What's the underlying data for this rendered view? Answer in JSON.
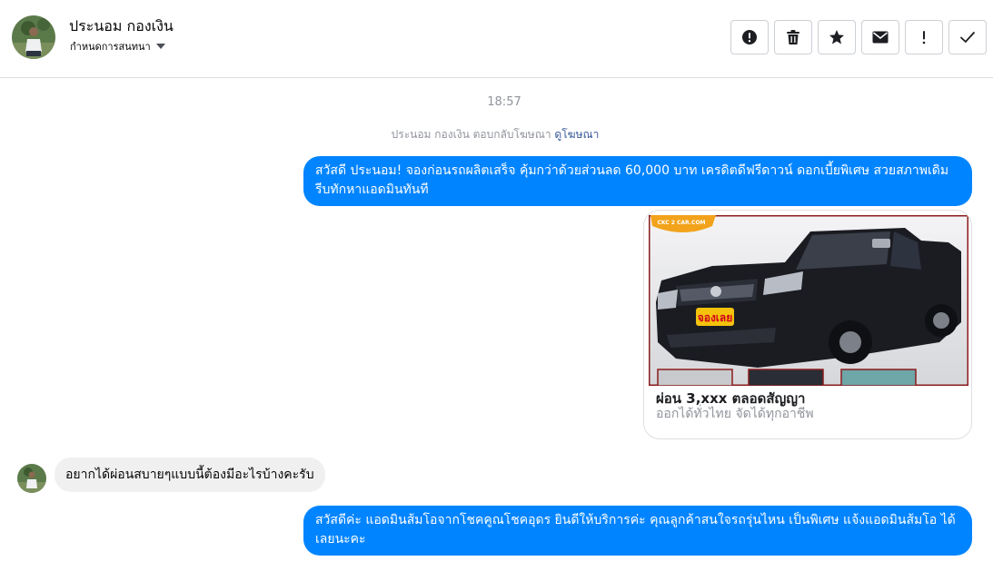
{
  "header": {
    "contact_name": "ประนอม กองเงิน",
    "conversation_settings_label": "กำหนดการสนทนา",
    "actions": [
      {
        "name": "report-button",
        "icon": "alert-circle-icon"
      },
      {
        "name": "delete-button",
        "icon": "trash-icon"
      },
      {
        "name": "star-button",
        "icon": "star-icon"
      },
      {
        "name": "mark-unread-button",
        "icon": "envelope-icon"
      },
      {
        "name": "important-button",
        "icon": "exclamation-icon"
      },
      {
        "name": "done-button",
        "icon": "check-icon"
      }
    ]
  },
  "thread": {
    "timestamp": "18:57",
    "ad_reply_note": {
      "text": "ประนอม กองเงิน ตอบกลับโฆษณา",
      "link": "ดูโฆษณา"
    },
    "messages": [
      {
        "direction": "outgoing",
        "text": "สวัสดี ประนอม! จองก่อนรถผลิตเสร็จ คุ้มกว่าด้วยส่วนลด 60,000 บาท เครดิตดีฟรีดาวน์ ดอกเบี้ยพิเศษ สวยสภาพเดิม รีบทักหาแอดมินทันที"
      },
      {
        "direction": "outgoing",
        "type": "ad-card",
        "image_watermark": "CKC 2 CAR.COM",
        "image_badge": "จองเลย",
        "title": "ผ่อน 3,xxx ตลอดสัญญา",
        "subtitle": "ออกได้ทั่วไทย จัดได้ทุกอาชีพ"
      },
      {
        "direction": "incoming",
        "text": "อยากได้ผ่อนสบายๆแบบนี้ต้องมีอะไรบ้างคะรับ"
      },
      {
        "direction": "outgoing",
        "text": "สวัสดีค่ะ แอดมินส้มโอจากโชคคูณโชคอุดร ยินดีให้บริการค่ะ   คุณลูกค้าสนใจรถรุ่นไหน เป็นพิเศษ แจ้งแอดมินส้มโอ ได้เลยนะคะ"
      }
    ]
  },
  "colors": {
    "outgoing_bubble": "#0084ff",
    "incoming_bubble": "#f1f0f0",
    "link": "#385898",
    "muted_text": "#90949c",
    "border": "#dadde1"
  }
}
